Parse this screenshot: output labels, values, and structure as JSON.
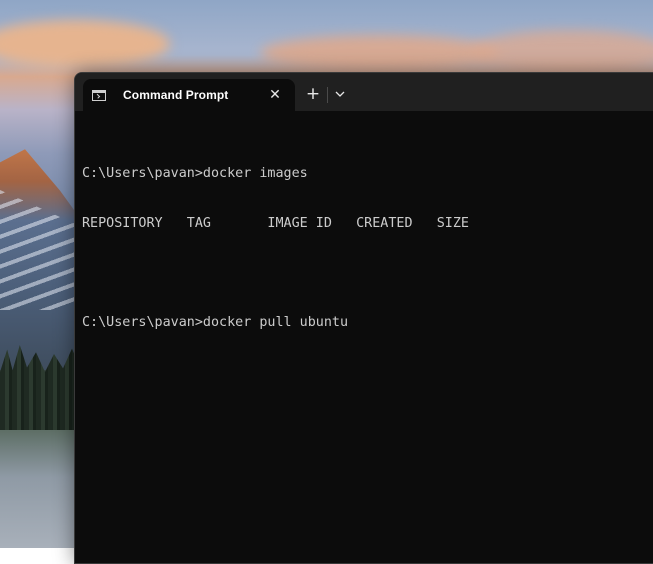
{
  "window": {
    "tab_title": "Command Prompt",
    "tab_close": "✕",
    "new_tab": "+"
  },
  "terminal": {
    "lines": [
      "C:\\Users\\pavan>docker images",
      "REPOSITORY   TAG       IMAGE ID   CREATED   SIZE",
      "",
      "C:\\Users\\pavan>docker pull ubuntu"
    ]
  },
  "icons": {
    "tab": "terminal-icon",
    "close": "close-icon",
    "new_tab": "plus-icon",
    "dropdown": "chevron-down-icon"
  },
  "colors": {
    "terminal_background": "#0c0c0c",
    "title_bar": "#202020",
    "text": "#cccccc"
  }
}
